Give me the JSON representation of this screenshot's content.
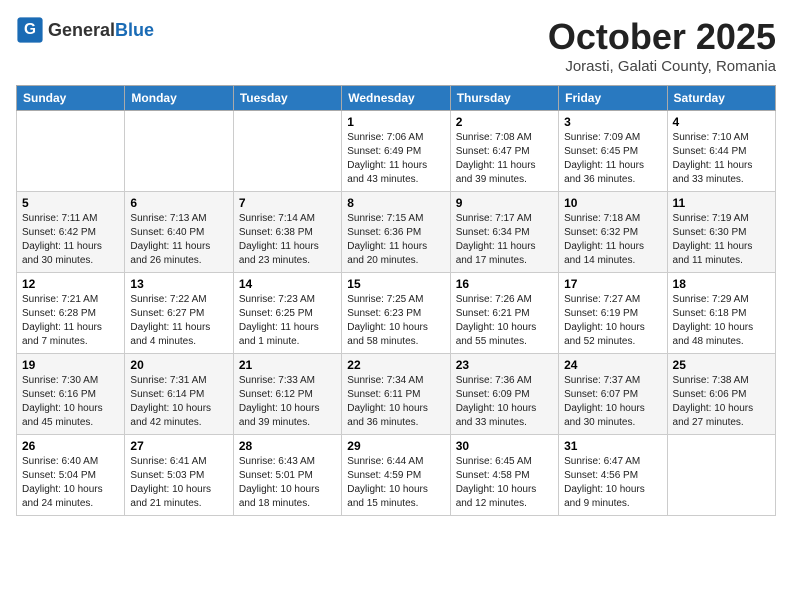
{
  "header": {
    "logo_general": "General",
    "logo_blue": "Blue",
    "month": "October 2025",
    "location": "Jorasti, Galati County, Romania"
  },
  "weekdays": [
    "Sunday",
    "Monday",
    "Tuesday",
    "Wednesday",
    "Thursday",
    "Friday",
    "Saturday"
  ],
  "weeks": [
    [
      {
        "day": "",
        "info": ""
      },
      {
        "day": "",
        "info": ""
      },
      {
        "day": "",
        "info": ""
      },
      {
        "day": "1",
        "info": "Sunrise: 7:06 AM\nSunset: 6:49 PM\nDaylight: 11 hours\nand 43 minutes."
      },
      {
        "day": "2",
        "info": "Sunrise: 7:08 AM\nSunset: 6:47 PM\nDaylight: 11 hours\nand 39 minutes."
      },
      {
        "day": "3",
        "info": "Sunrise: 7:09 AM\nSunset: 6:45 PM\nDaylight: 11 hours\nand 36 minutes."
      },
      {
        "day": "4",
        "info": "Sunrise: 7:10 AM\nSunset: 6:44 PM\nDaylight: 11 hours\nand 33 minutes."
      }
    ],
    [
      {
        "day": "5",
        "info": "Sunrise: 7:11 AM\nSunset: 6:42 PM\nDaylight: 11 hours\nand 30 minutes."
      },
      {
        "day": "6",
        "info": "Sunrise: 7:13 AM\nSunset: 6:40 PM\nDaylight: 11 hours\nand 26 minutes."
      },
      {
        "day": "7",
        "info": "Sunrise: 7:14 AM\nSunset: 6:38 PM\nDaylight: 11 hours\nand 23 minutes."
      },
      {
        "day": "8",
        "info": "Sunrise: 7:15 AM\nSunset: 6:36 PM\nDaylight: 11 hours\nand 20 minutes."
      },
      {
        "day": "9",
        "info": "Sunrise: 7:17 AM\nSunset: 6:34 PM\nDaylight: 11 hours\nand 17 minutes."
      },
      {
        "day": "10",
        "info": "Sunrise: 7:18 AM\nSunset: 6:32 PM\nDaylight: 11 hours\nand 14 minutes."
      },
      {
        "day": "11",
        "info": "Sunrise: 7:19 AM\nSunset: 6:30 PM\nDaylight: 11 hours\nand 11 minutes."
      }
    ],
    [
      {
        "day": "12",
        "info": "Sunrise: 7:21 AM\nSunset: 6:28 PM\nDaylight: 11 hours\nand 7 minutes."
      },
      {
        "day": "13",
        "info": "Sunrise: 7:22 AM\nSunset: 6:27 PM\nDaylight: 11 hours\nand 4 minutes."
      },
      {
        "day": "14",
        "info": "Sunrise: 7:23 AM\nSunset: 6:25 PM\nDaylight: 11 hours\nand 1 minute."
      },
      {
        "day": "15",
        "info": "Sunrise: 7:25 AM\nSunset: 6:23 PM\nDaylight: 10 hours\nand 58 minutes."
      },
      {
        "day": "16",
        "info": "Sunrise: 7:26 AM\nSunset: 6:21 PM\nDaylight: 10 hours\nand 55 minutes."
      },
      {
        "day": "17",
        "info": "Sunrise: 7:27 AM\nSunset: 6:19 PM\nDaylight: 10 hours\nand 52 minutes."
      },
      {
        "day": "18",
        "info": "Sunrise: 7:29 AM\nSunset: 6:18 PM\nDaylight: 10 hours\nand 48 minutes."
      }
    ],
    [
      {
        "day": "19",
        "info": "Sunrise: 7:30 AM\nSunset: 6:16 PM\nDaylight: 10 hours\nand 45 minutes."
      },
      {
        "day": "20",
        "info": "Sunrise: 7:31 AM\nSunset: 6:14 PM\nDaylight: 10 hours\nand 42 minutes."
      },
      {
        "day": "21",
        "info": "Sunrise: 7:33 AM\nSunset: 6:12 PM\nDaylight: 10 hours\nand 39 minutes."
      },
      {
        "day": "22",
        "info": "Sunrise: 7:34 AM\nSunset: 6:11 PM\nDaylight: 10 hours\nand 36 minutes."
      },
      {
        "day": "23",
        "info": "Sunrise: 7:36 AM\nSunset: 6:09 PM\nDaylight: 10 hours\nand 33 minutes."
      },
      {
        "day": "24",
        "info": "Sunrise: 7:37 AM\nSunset: 6:07 PM\nDaylight: 10 hours\nand 30 minutes."
      },
      {
        "day": "25",
        "info": "Sunrise: 7:38 AM\nSunset: 6:06 PM\nDaylight: 10 hours\nand 27 minutes."
      }
    ],
    [
      {
        "day": "26",
        "info": "Sunrise: 6:40 AM\nSunset: 5:04 PM\nDaylight: 10 hours\nand 24 minutes."
      },
      {
        "day": "27",
        "info": "Sunrise: 6:41 AM\nSunset: 5:03 PM\nDaylight: 10 hours\nand 21 minutes."
      },
      {
        "day": "28",
        "info": "Sunrise: 6:43 AM\nSunset: 5:01 PM\nDaylight: 10 hours\nand 18 minutes."
      },
      {
        "day": "29",
        "info": "Sunrise: 6:44 AM\nSunset: 4:59 PM\nDaylight: 10 hours\nand 15 minutes."
      },
      {
        "day": "30",
        "info": "Sunrise: 6:45 AM\nSunset: 4:58 PM\nDaylight: 10 hours\nand 12 minutes."
      },
      {
        "day": "31",
        "info": "Sunrise: 6:47 AM\nSunset: 4:56 PM\nDaylight: 10 hours\nand 9 minutes."
      },
      {
        "day": "",
        "info": ""
      }
    ]
  ]
}
